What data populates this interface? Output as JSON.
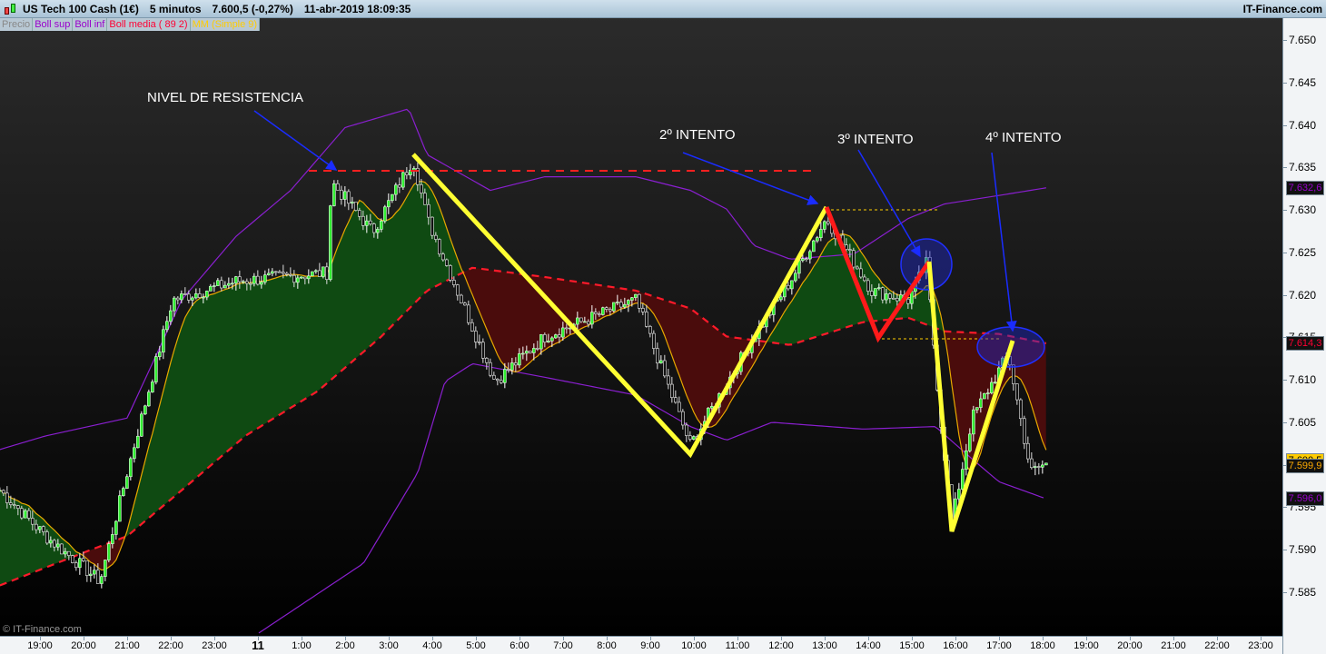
{
  "header": {
    "instrument": "US Tech 100 Cash (1€)",
    "timeframe": "5 minutos",
    "price": "7.600,5 (-0,27%)",
    "datetime": "11-abr-2019 18:09:35",
    "site": "IT-Finance.com"
  },
  "legend": [
    {
      "label": "Precio",
      "color": "#888888"
    },
    {
      "label": "Boll sup",
      "color": "#9900cc"
    },
    {
      "label": "Boll inf",
      "color": "#9900cc"
    },
    {
      "label": "Boll media ( 89 2)",
      "color": "#ff0033"
    },
    {
      "label": "MM (Simple 9)",
      "color": "#ffcc00"
    }
  ],
  "watermark": "© IT-Finance.com",
  "annotations": {
    "resistance": "NIVEL DE RESISTENCIA",
    "second": "2º INTENTO",
    "third": "3º INTENTO",
    "fourth": "4º INTENTO"
  },
  "badges": [
    {
      "value": "7.632,6",
      "price": 7.6326,
      "color": "#9900cc",
      "bg": "#111111"
    },
    {
      "value": "7.614,3",
      "price": 7.6143,
      "color": "#ff0033",
      "bg": "#111111"
    },
    {
      "value": "7.600,5",
      "price": 7.6005,
      "color": "#000000",
      "bg": "#ffcc00"
    },
    {
      "value": "7.599,9",
      "price": 7.5999,
      "color": "#ffaa00",
      "bg": "#111111"
    },
    {
      "value": "7.596,0",
      "price": 7.596,
      "color": "#9900cc",
      "bg": "#111111"
    }
  ],
  "chart_data": {
    "type": "candlestick",
    "time_unit": "hours since 19:00 (10-abr)",
    "ylim": [
      7.58,
      7.652
    ],
    "y_ticks": [
      "7.650",
      "7.645",
      "7.640",
      "7.635",
      "7.630",
      "7.625",
      "7.620",
      "7.615",
      "7.610",
      "7.605",
      "7.600",
      "7.595",
      "7.590",
      "7.585"
    ],
    "x_ticks": [
      "19:00",
      "20:00",
      "21:00",
      "22:00",
      "23:00",
      "11",
      "1:00",
      "2:00",
      "3:00",
      "4:00",
      "5:00",
      "6:00",
      "7:00",
      "8:00",
      "9:00",
      "10:00",
      "11:00",
      "12:00",
      "13:00",
      "14:00",
      "15:00",
      "16:00",
      "17:00",
      "18:00",
      "19:00",
      "20:00",
      "21:00",
      "22:00",
      "23:00"
    ],
    "close_path": [
      [
        -0.92,
        7.597
      ],
      [
        0.13,
        7.5916
      ],
      [
        1.38,
        7.5863
      ],
      [
        2.0,
        7.5991
      ],
      [
        3.04,
        7.6194
      ],
      [
        4.5,
        7.6216
      ],
      [
        6.58,
        7.6226
      ],
      [
        6.69,
        7.6333
      ],
      [
        7.63,
        7.6274
      ],
      [
        8.56,
        7.636
      ],
      [
        8.88,
        7.629
      ],
      [
        10.44,
        7.6098
      ],
      [
        11.58,
        7.6151
      ],
      [
        13.67,
        7.6194
      ],
      [
        14.92,
        7.6023
      ],
      [
        16.38,
        7.6151
      ],
      [
        17.21,
        7.6216
      ],
      [
        18.04,
        7.629
      ],
      [
        19.08,
        7.6205
      ],
      [
        19.92,
        7.6194
      ],
      [
        20.33,
        7.6237
      ],
      [
        20.65,
        7.6055
      ],
      [
        20.92,
        7.5932
      ],
      [
        21.38,
        7.6055
      ],
      [
        22.21,
        7.613
      ],
      [
        22.73,
        7.5991
      ],
      [
        23.08,
        7.6002
      ]
    ],
    "boll_sup": [
      [
        -0.92,
        7.6018
      ],
      [
        0.13,
        7.6034
      ],
      [
        2.0,
        7.6055
      ],
      [
        3.25,
        7.6194
      ],
      [
        4.5,
        7.6269
      ],
      [
        5.75,
        7.6323
      ],
      [
        7.0,
        7.6397
      ],
      [
        8.46,
        7.6419
      ],
      [
        8.88,
        7.6365
      ],
      [
        10.33,
        7.6323
      ],
      [
        11.58,
        7.6339
      ],
      [
        13.67,
        7.6339
      ],
      [
        14.92,
        7.6323
      ],
      [
        15.75,
        7.6301
      ],
      [
        16.38,
        7.6258
      ],
      [
        17.21,
        7.6242
      ],
      [
        18.67,
        7.6248
      ],
      [
        19.92,
        7.629
      ],
      [
        20.75,
        7.6307
      ],
      [
        22.0,
        7.6317
      ],
      [
        23.08,
        7.6326
      ]
    ],
    "boll_inf": [
      [
        5.02,
        7.5802
      ],
      [
        7.42,
        7.5884
      ],
      [
        8.67,
        7.5991
      ],
      [
        9.29,
        7.6098
      ],
      [
        9.92,
        7.6119
      ],
      [
        11.58,
        7.6103
      ],
      [
        13.67,
        7.6082
      ],
      [
        14.92,
        7.6045
      ],
      [
        15.75,
        7.6029
      ],
      [
        16.79,
        7.605
      ],
      [
        18.88,
        7.6042
      ],
      [
        20.54,
        7.6045
      ],
      [
        21.38,
        7.6007
      ],
      [
        22.0,
        7.598
      ],
      [
        23.08,
        7.596
      ]
    ],
    "boll_media": [
      [
        -0.92,
        7.5858
      ],
      [
        1.17,
        7.59
      ],
      [
        2.0,
        7.5916
      ],
      [
        3.25,
        7.597
      ],
      [
        4.71,
        7.6034
      ],
      [
        6.38,
        7.6087
      ],
      [
        7.83,
        7.6151
      ],
      [
        8.88,
        7.6205
      ],
      [
        9.92,
        7.6232
      ],
      [
        11.58,
        7.6221
      ],
      [
        13.67,
        7.6205
      ],
      [
        14.92,
        7.6184
      ],
      [
        15.75,
        7.6151
      ],
      [
        17.21,
        7.6141
      ],
      [
        18.88,
        7.6168
      ],
      [
        19.92,
        7.6173
      ],
      [
        20.75,
        7.6157
      ],
      [
        22.0,
        7.6154
      ],
      [
        23.08,
        7.6143
      ]
    ],
    "resistance_level": 7.6345
  }
}
